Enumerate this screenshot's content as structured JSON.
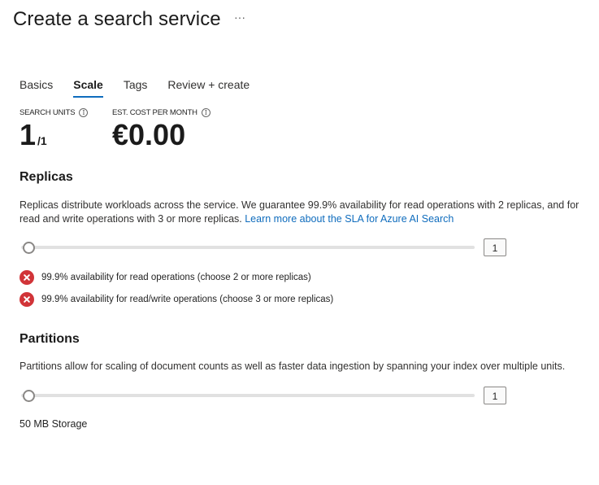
{
  "page": {
    "title": "Create a search service",
    "more_label": "···"
  },
  "tabs": [
    {
      "label": "Basics",
      "active": false
    },
    {
      "label": "Scale",
      "active": true
    },
    {
      "label": "Tags",
      "active": false
    },
    {
      "label": "Review + create",
      "active": false
    }
  ],
  "metrics": {
    "search_units": {
      "label": "SEARCH UNITS",
      "value": "1",
      "suffix": "/1"
    },
    "cost": {
      "label": "EST. COST PER MONTH",
      "value": "€0.00"
    }
  },
  "replicas": {
    "title": "Replicas",
    "description": "Replicas distribute workloads across the service. We guarantee 99.9% availability for read operations with 2 replicas, and for read and write operations with 3 or more replicas.",
    "link_text": "Learn more about the SLA for Azure AI Search",
    "value": "1",
    "statuses": [
      "99.9% availability for read operations (choose 2 or more replicas)",
      "99.9% availability for read/write operations (choose 3 or more replicas)"
    ]
  },
  "partitions": {
    "title": "Partitions",
    "description": "Partitions allow for scaling of document counts as well as faster data ingestion by spanning your index over multiple units.",
    "value": "1",
    "storage": "50 MB Storage"
  },
  "colors": {
    "accent": "#0f6cbd",
    "error": "#d13438"
  }
}
